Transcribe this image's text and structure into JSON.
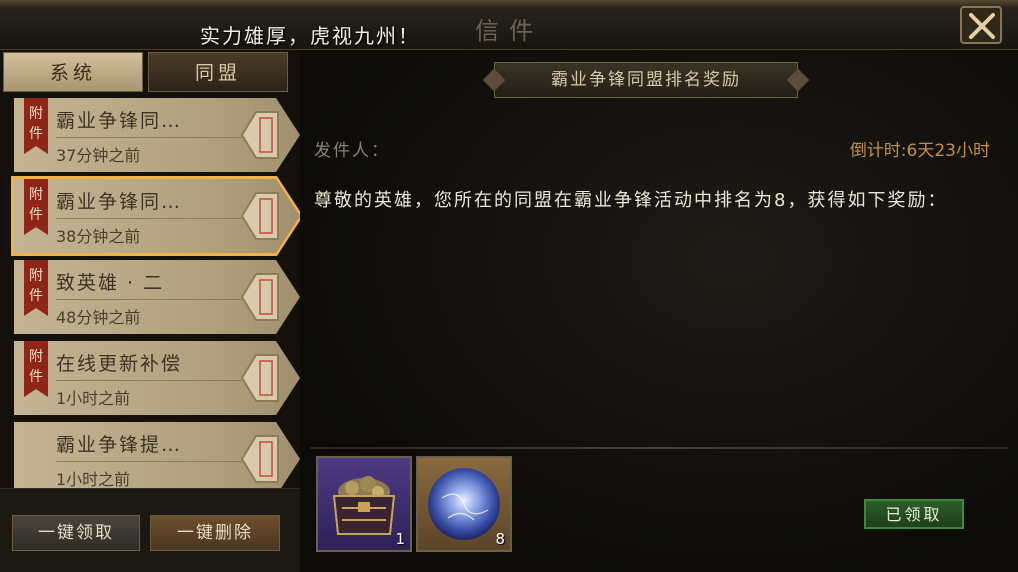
{
  "window": {
    "title": "信件",
    "broadcast": "实力雄厚，虎视九州！"
  },
  "tabs": [
    {
      "label": "系统"
    },
    {
      "label": "同盟"
    }
  ],
  "mail_list": [
    {
      "tag": "附件",
      "title": "霸业争锋同…",
      "time": "37分钟之前"
    },
    {
      "tag": "附件",
      "title": "霸业争锋同…",
      "time": "38分钟之前"
    },
    {
      "tag": "附件",
      "title": "致英雄 · 二",
      "time": "48分钟之前"
    },
    {
      "tag": "附件",
      "title": "在线更新补偿",
      "time": "1小时之前"
    },
    {
      "tag": "",
      "title": "霸业争锋提…",
      "time": "1小时之前"
    }
  ],
  "buttons": {
    "claim_all": "一键领取",
    "delete_all": "一键删除",
    "claimed": "已领取"
  },
  "mail": {
    "header": "霸业争锋同盟排名奖励",
    "sender_label": "发件人：",
    "countdown": "倒计时:6天23小时",
    "body": "尊敬的英雄，您所在的同盟在霸业争锋活动中排名为8，获得如下奖励："
  },
  "rewards": [
    {
      "icon": "treasure-chest-icon",
      "qty": "1"
    },
    {
      "icon": "blue-orb-icon",
      "qty": "8"
    }
  ],
  "colors": {
    "accent": "#f1b444",
    "tag": "#8f2418",
    "countdown": "#c4923f",
    "claimed": "#3c8a3a"
  }
}
